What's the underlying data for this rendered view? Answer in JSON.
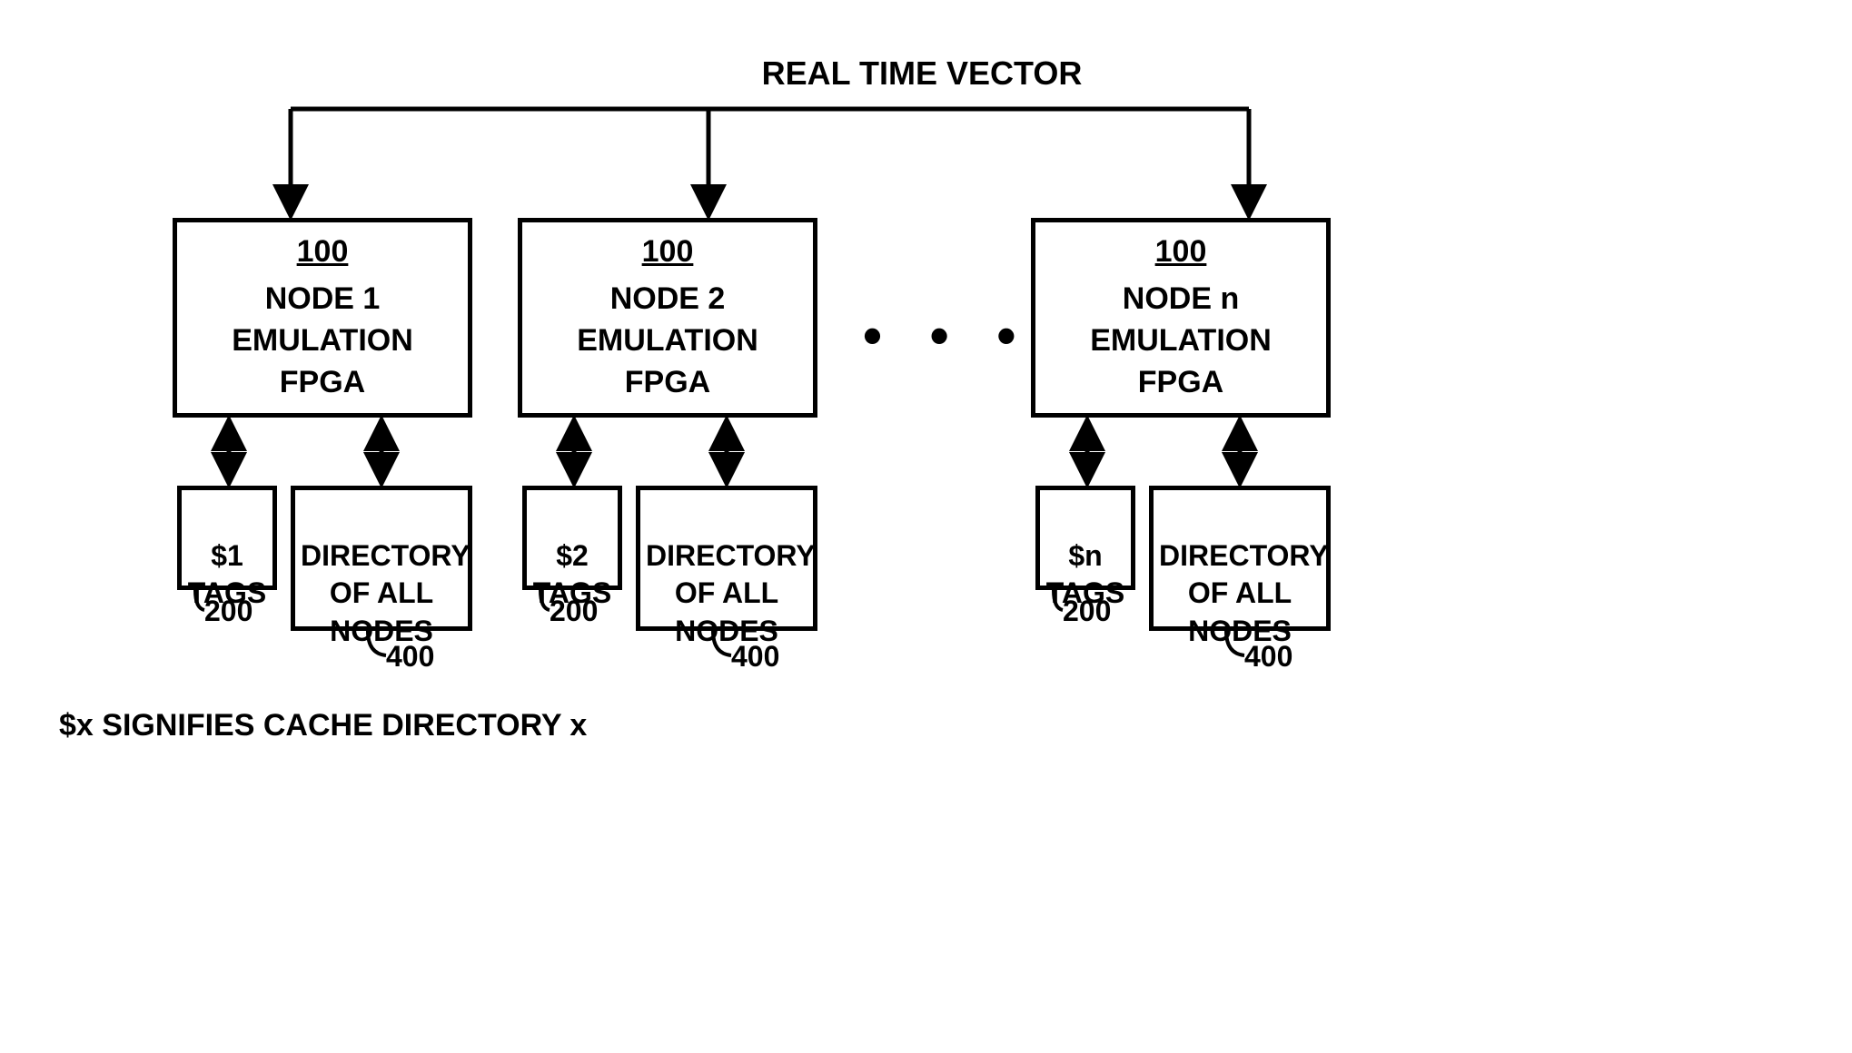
{
  "title": "REAL TIME VECTOR",
  "nodes": [
    {
      "ref": "100",
      "body": "NODE 1\nEMULATION\nFPGA"
    },
    {
      "ref": "100",
      "body": "NODE 2\nEMULATION\nFPGA"
    },
    {
      "ref": "100",
      "body": "NODE n\nEMULATION\nFPGA"
    }
  ],
  "tags": [
    {
      "text": "$1\nTAGS",
      "ref": "200"
    },
    {
      "text": "$2\nTAGS",
      "ref": "200"
    },
    {
      "text": "$n\nTAGS",
      "ref": "200"
    }
  ],
  "directories": [
    {
      "text": "DIRECTORY\nOF ALL\nNODES",
      "ref": "400"
    },
    {
      "text": "DIRECTORY\nOF ALL\nNODES",
      "ref": "400"
    },
    {
      "text": "DIRECTORY\nOF ALL\nNODES",
      "ref": "400"
    }
  ],
  "ellipsis": "• • •",
  "footnote": "$x SIGNIFIES CACHE DIRECTORY x"
}
